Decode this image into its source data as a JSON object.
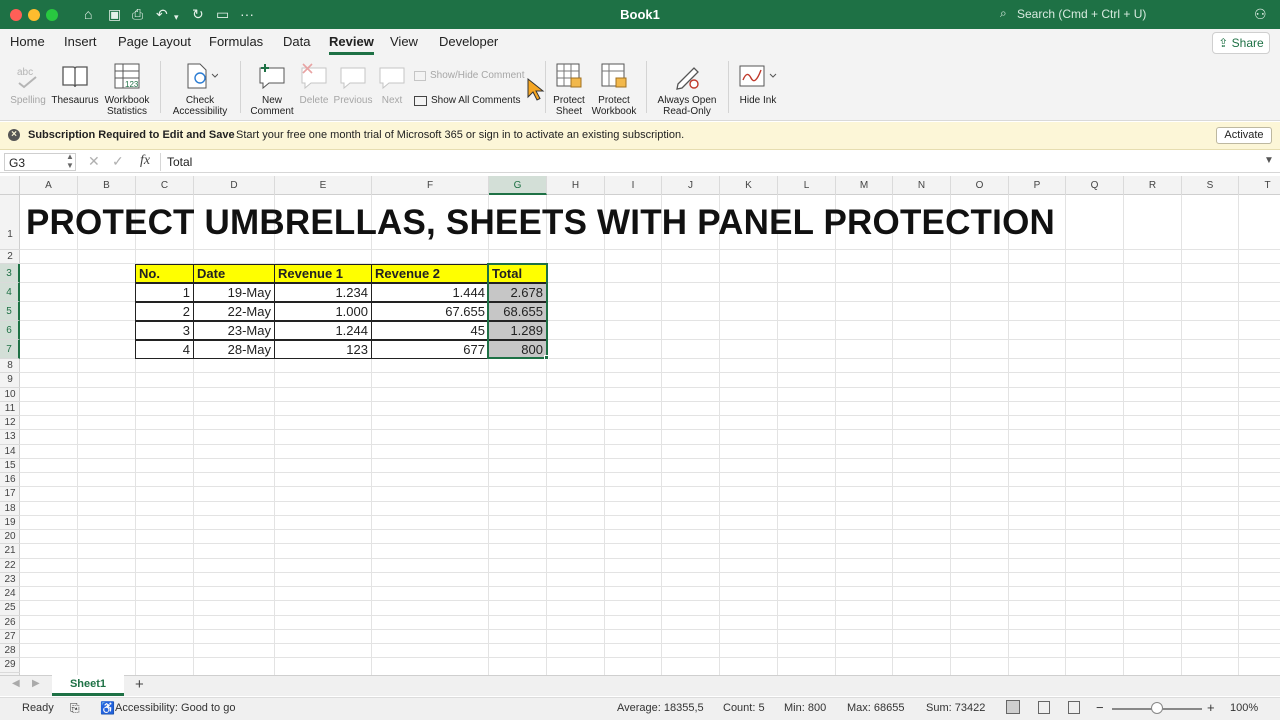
{
  "window": {
    "title": "Book1",
    "search_placeholder": "Search (Cmd + Ctrl + U)"
  },
  "menu": {
    "tabs": [
      "Home",
      "Insert",
      "Page Layout",
      "Formulas",
      "Data",
      "Review",
      "View",
      "Developer"
    ],
    "active_tab": "Review",
    "share_label": "Share"
  },
  "ribbon": {
    "spelling": "Spelling",
    "thesaurus": "Thesaurus",
    "workbook_statistics": [
      "Workbook",
      "Statistics"
    ],
    "check_accessibility": [
      "Check",
      "Accessibility"
    ],
    "new_comment": [
      "New",
      "Comment"
    ],
    "delete": "Delete",
    "previous": "Previous",
    "next": "Next",
    "show_hide_comment": "Show/Hide Comment",
    "show_all_comments": "Show All Comments",
    "protect_sheet": [
      "Protect",
      "Sheet"
    ],
    "protect_workbook": [
      "Protect",
      "Workbook"
    ],
    "always_open_readonly": [
      "Always Open",
      "Read-Only"
    ],
    "hide_ink": "Hide Ink"
  },
  "message_bar": {
    "title": "Subscription Required to Edit and Save",
    "text": "Start your free one month trial of Microsoft 365 or sign in to activate an existing subscription.",
    "button": "Activate"
  },
  "formula_bar": {
    "name_box": "G3",
    "fx": "fx",
    "content": "Total"
  },
  "columns": [
    "A",
    "B",
    "C",
    "D",
    "E",
    "F",
    "G",
    "H",
    "I",
    "J",
    "K",
    "L",
    "M",
    "N",
    "O",
    "P",
    "Q",
    "R",
    "S",
    "T"
  ],
  "selected_column": "G",
  "rows": [
    "1",
    "2",
    "3",
    "4",
    "5",
    "6",
    "7",
    "8",
    "9",
    "10",
    "11",
    "12",
    "13",
    "14",
    "15",
    "16",
    "17",
    "18",
    "19",
    "20",
    "21",
    "22",
    "23",
    "24",
    "25",
    "26",
    "27",
    "28",
    "29"
  ],
  "sheet": {
    "title": "PROTECT UMBRELLAS, SHEETS WITH PANEL PROTECTION",
    "table": {
      "headers": [
        "No.",
        "Date",
        "Revenue 1",
        "Revenue 2",
        "Total"
      ],
      "rows": [
        [
          "1",
          "19-May",
          "1.234",
          "1.444",
          "2.678"
        ],
        [
          "2",
          "22-May",
          "1.000",
          "67.655",
          "68.655"
        ],
        [
          "3",
          "23-May",
          "1.244",
          "45",
          "1.289"
        ],
        [
          "4",
          "28-May",
          "123",
          "677",
          "800"
        ]
      ]
    }
  },
  "tabs": {
    "sheet_tab": "Sheet1",
    "add": "+"
  },
  "status": {
    "ready": "Ready",
    "accessibility": "Accessibility: Good to go",
    "average": "Average: 18355,5",
    "count": "Count: 5",
    "min": "Min: 800",
    "max": "Max: 68655",
    "sum": "Sum: 73422",
    "zoom": "100%",
    "zoom_minus": "−",
    "zoom_plus": "+"
  },
  "colors": {
    "excel_green": "#1e7145",
    "header_fill": "#ffff00",
    "total_fill": "#c6c6c6"
  }
}
